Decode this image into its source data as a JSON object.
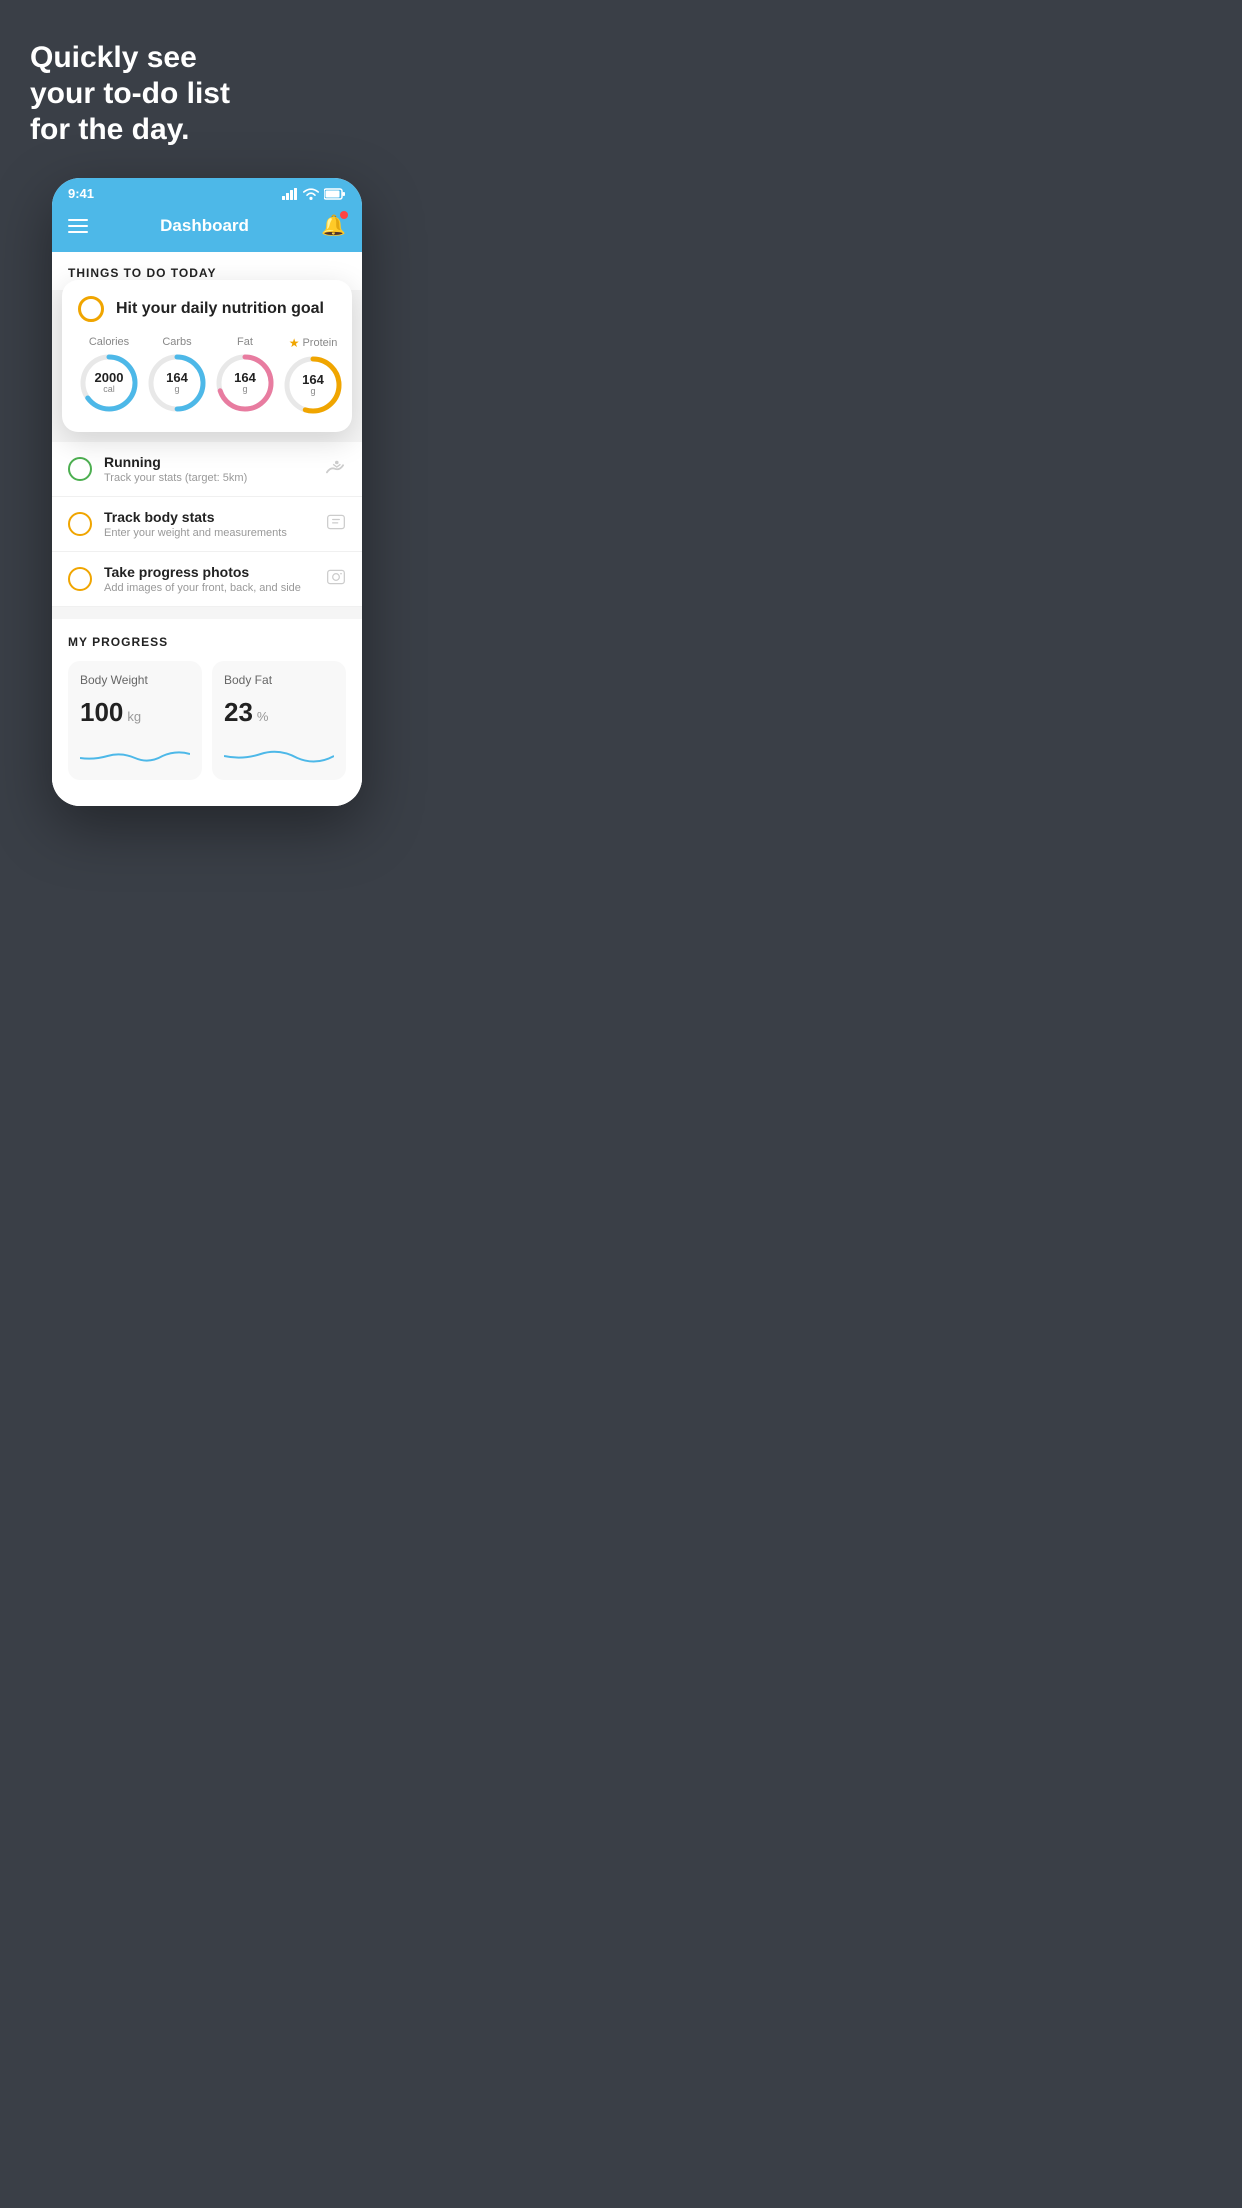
{
  "headline": "Quickly see\nyour to-do list\nfor the day.",
  "status_bar": {
    "time": "9:41"
  },
  "header": {
    "title": "Dashboard"
  },
  "things_section": {
    "title": "THINGS TO DO TODAY"
  },
  "featured_card": {
    "title": "Hit your daily nutrition goal",
    "nutrition": [
      {
        "label": "Calories",
        "value": "2000",
        "unit": "cal",
        "color": "#4db8e8",
        "pct": 65
      },
      {
        "label": "Carbs",
        "value": "164",
        "unit": "g",
        "color": "#4db8e8",
        "pct": 50
      },
      {
        "label": "Fat",
        "value": "164",
        "unit": "g",
        "color": "#e87ca0",
        "pct": 70
      },
      {
        "label": "Protein",
        "value": "164",
        "unit": "g",
        "color": "#f0a500",
        "pct": 55
      }
    ]
  },
  "tasks": [
    {
      "name": "Running",
      "sub": "Track your stats (target: 5km)",
      "circle_color": "green",
      "icon": "👟"
    },
    {
      "name": "Track body stats",
      "sub": "Enter your weight and measurements",
      "circle_color": "yellow",
      "icon": "⚖️"
    },
    {
      "name": "Take progress photos",
      "sub": "Add images of your front, back, and side",
      "circle_color": "yellow",
      "icon": "🖼️"
    }
  ],
  "progress": {
    "title": "MY PROGRESS",
    "cards": [
      {
        "title": "Body Weight",
        "value": "100",
        "unit": "kg"
      },
      {
        "title": "Body Fat",
        "value": "23",
        "unit": "%"
      }
    ]
  }
}
